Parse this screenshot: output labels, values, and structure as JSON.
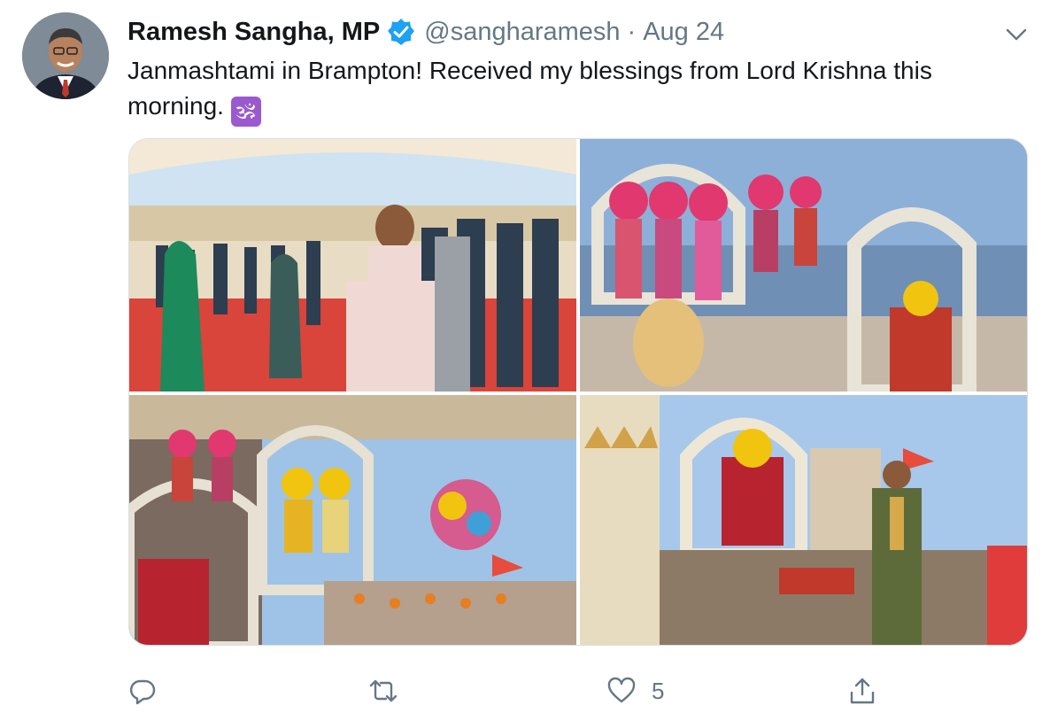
{
  "tweet": {
    "author_name": "Ramesh Sangha, MP",
    "handle": "@sangharamesh",
    "separator": "·",
    "date": "Aug 24",
    "verified": true,
    "text": "Janmashtami in Brampton! Received my blessings from Lord Krishna this morning.",
    "emoji": "🕉",
    "likes_count": "5"
  },
  "colors": {
    "verified_blue": "#1da1f2",
    "secondary_text": "#657786",
    "om_purple": "#9b59d0"
  },
  "icons": [
    "verified-badge-icon",
    "chevron-down-icon",
    "reply-icon",
    "retweet-icon",
    "like-icon",
    "share-icon"
  ]
}
